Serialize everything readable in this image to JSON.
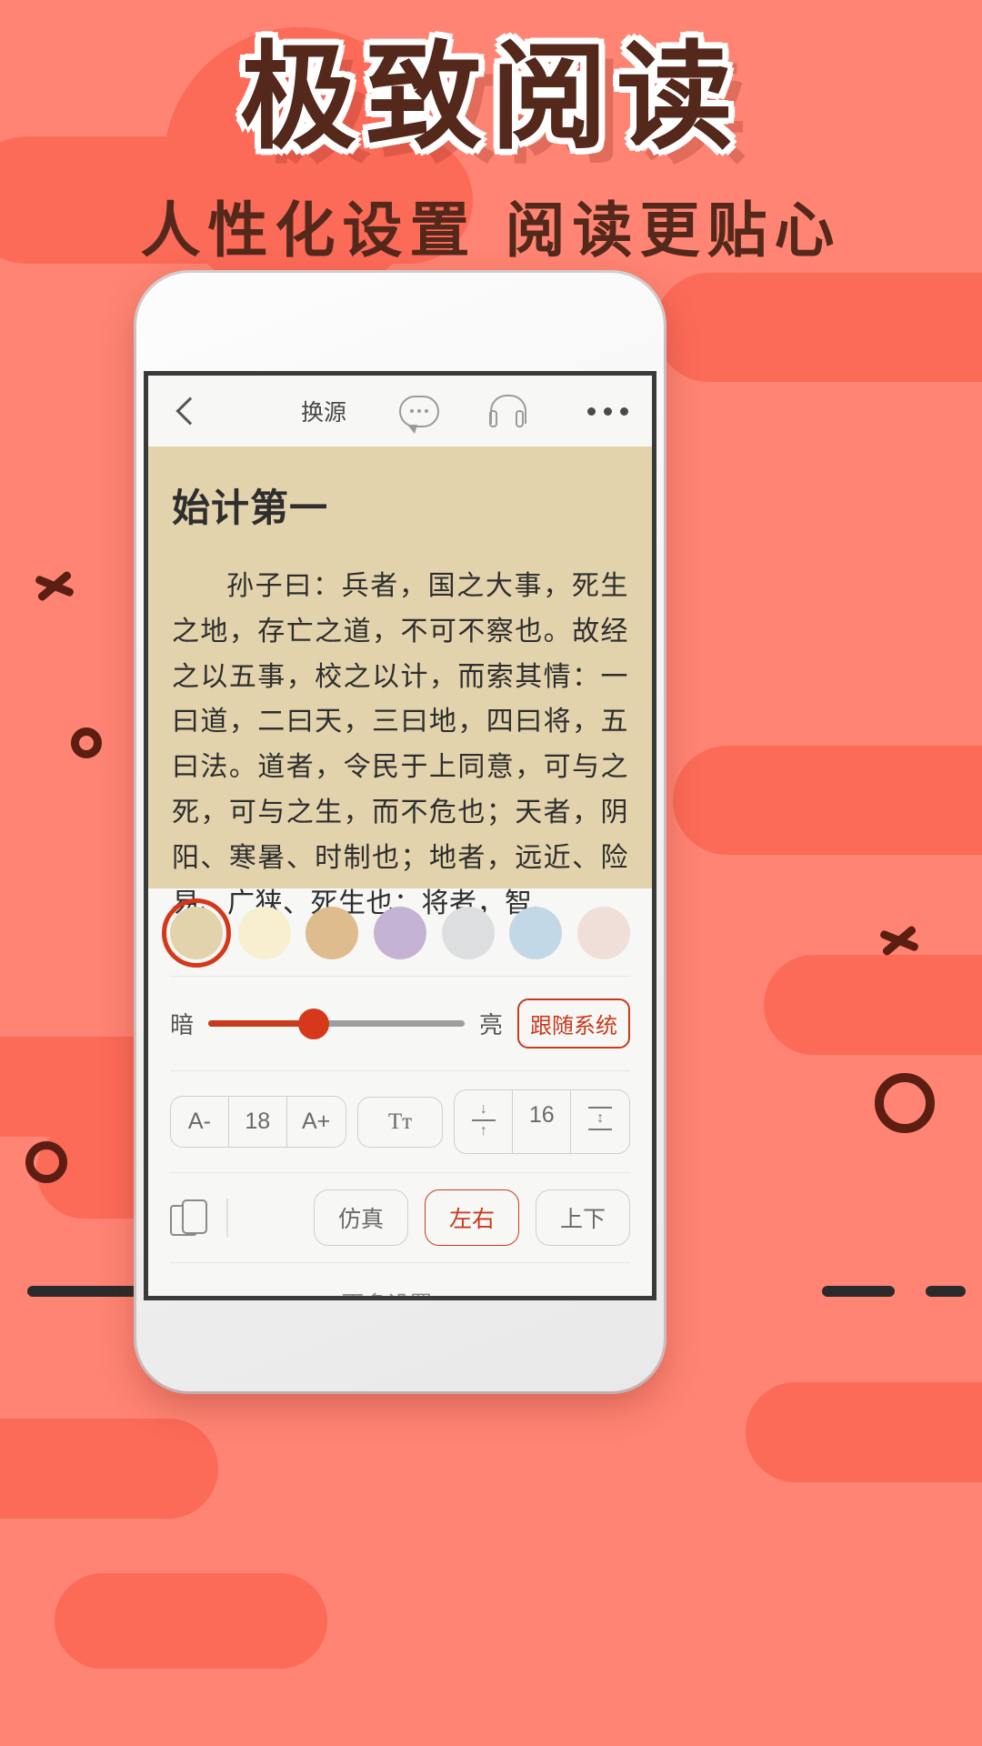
{
  "promo": {
    "title": "极致阅读",
    "subtitle": "人性化设置 阅读更贴心",
    "bg_color": "#FF8473",
    "accent_color": "#54281A",
    "blob_color": "#FC6A58"
  },
  "reader": {
    "toolbar": {
      "back_icon": "chevron-left-icon",
      "source_label": "换源",
      "comment_icon": "speech-bubble-icon",
      "listen_icon": "headphone-icon",
      "more_icon": "ellipsis-icon"
    },
    "page": {
      "chapter_title": "始计第一",
      "body": "孙子曰：兵者，国之大事，死生之地，存亡之道，不可不察也。故经之以五事，校之以计，而索其情：一曰道，二曰天，三曰地，四曰将，五曰法。道者，令民于上同意，可与之死，可与之生，而不危也；天者，阴阳、寒暑、时制也；地者，远近、险易、广狭、死生也；将者，智、",
      "bg_color": "#E3D3AD"
    },
    "settings": {
      "themes": [
        {
          "name": "tan",
          "color": "#E3D3AD",
          "selected": true
        },
        {
          "name": "cream",
          "color": "#F7EFCF",
          "selected": false
        },
        {
          "name": "khaki",
          "color": "#DFBC8E",
          "selected": false
        },
        {
          "name": "lavender",
          "color": "#C4B3D4",
          "selected": false
        },
        {
          "name": "gray",
          "color": "#DCDEE0",
          "selected": false
        },
        {
          "name": "blue",
          "color": "#C3D8E6",
          "selected": false
        },
        {
          "name": "pink",
          "color": "#F0DFD8",
          "selected": false
        }
      ],
      "brightness": {
        "dark_label": "暗",
        "bright_label": "亮",
        "value_percent": 41,
        "follow_system_label": "跟随系统",
        "accent": "#C93A1C"
      },
      "font": {
        "decrease_label": "A-",
        "size_value": "18",
        "increase_label": "A+",
        "typeface_label": "Tт",
        "typeface_icon": "font-family-icon",
        "line_decrease_icon": "line-spacing-decrease-icon",
        "line_value": "16",
        "line_increase_icon": "line-spacing-increase-icon"
      },
      "layout": {
        "orientation_icon": "screen-rotate-icon",
        "modes": [
          {
            "label": "仿真",
            "selected": false
          },
          {
            "label": "左右",
            "selected": true
          },
          {
            "label": "上下",
            "selected": false
          }
        ]
      },
      "more_label": "更多设置>>"
    }
  }
}
